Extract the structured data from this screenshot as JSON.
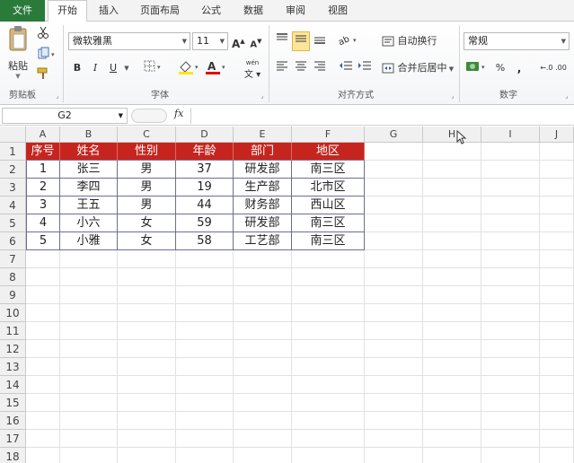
{
  "ribbon_tabs": [
    {
      "label": "文件"
    },
    {
      "label": "开始"
    },
    {
      "label": "插入"
    },
    {
      "label": "页面布局"
    },
    {
      "label": "公式"
    },
    {
      "label": "数据"
    },
    {
      "label": "审阅"
    },
    {
      "label": "视图"
    }
  ],
  "clipboard": {
    "paste_label": "粘贴",
    "group_label": "剪贴板"
  },
  "font": {
    "name": "微软雅黑",
    "size": "11",
    "group_label": "字体",
    "bold": "B",
    "italic": "I",
    "underline": "U",
    "grow": "A",
    "shrink": "A",
    "phonetic": "wén"
  },
  "alignment": {
    "wrap_label": "自动换行",
    "merge_label": "合并后居中",
    "group_label": "对齐方式"
  },
  "number": {
    "format": "常规",
    "group_label": "数字",
    "percent": "%",
    "comma": ",",
    "decimals": "←.0 .00"
  },
  "formula_bar": {
    "name_box": "G2",
    "fx": "fx",
    "value": ""
  },
  "columns": [
    "A",
    "B",
    "C",
    "D",
    "E",
    "F",
    "G",
    "H",
    "I",
    "J"
  ],
  "rows": [
    "1",
    "2",
    "3",
    "4",
    "5",
    "6",
    "7",
    "8",
    "9",
    "10",
    "11",
    "12",
    "13",
    "14",
    "15",
    "16",
    "17",
    "18"
  ],
  "table": {
    "headers": [
      "序号",
      "姓名",
      "性别",
      "年龄",
      "部门",
      "地区"
    ],
    "rows": [
      [
        "1",
        "张三",
        "男",
        "37",
        "研发部",
        "南三区"
      ],
      [
        "2",
        "李四",
        "男",
        "19",
        "生产部",
        "北市区"
      ],
      [
        "3",
        "王五",
        "男",
        "44",
        "财务部",
        "西山区"
      ],
      [
        "4",
        "小六",
        "女",
        "59",
        "研发部",
        "南三区"
      ],
      [
        "5",
        "小雅",
        "女",
        "58",
        "工艺部",
        "南三区"
      ]
    ]
  },
  "colors": {
    "header_fill": "#c6251f",
    "file_tab": "#2a7a3a",
    "table_border": "#6d6d96"
  }
}
